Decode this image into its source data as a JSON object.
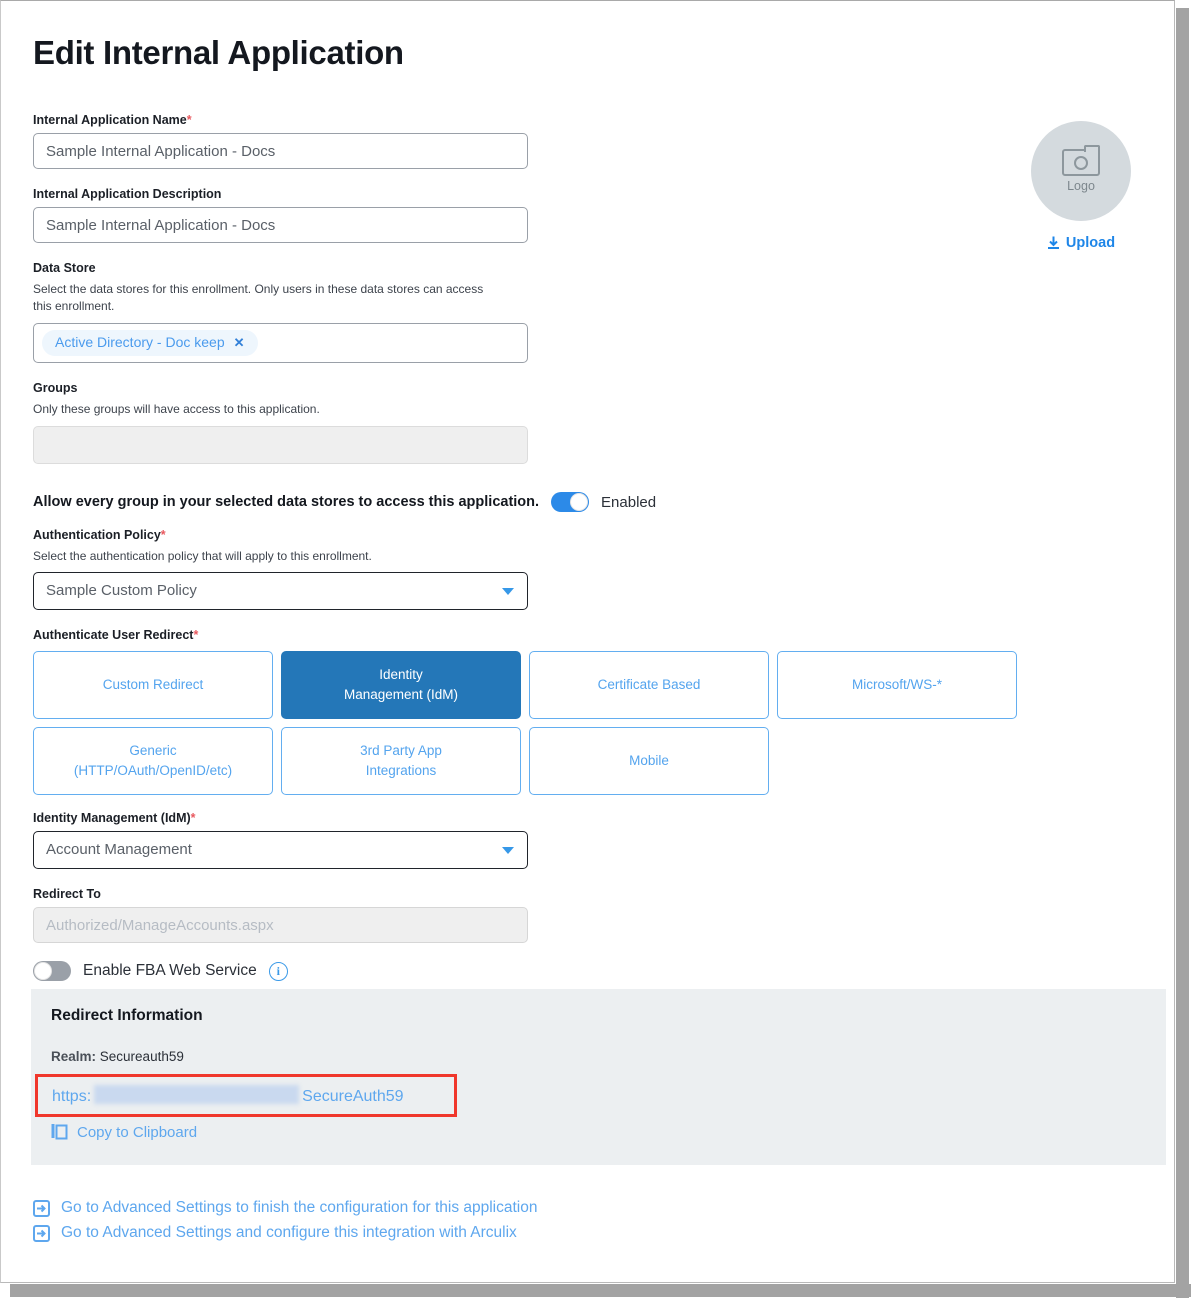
{
  "page": {
    "title": "Edit Internal Application"
  },
  "logo": {
    "placeholder_label": "Logo",
    "upload_label": "Upload",
    "camera_icon": "camera-icon",
    "download_icon": "download-icon"
  },
  "fields": {
    "app_name": {
      "label": "Internal Application Name",
      "required": true,
      "value": "Sample Internal Application - Docs"
    },
    "app_description": {
      "label": "Internal Application Description",
      "required": false,
      "value": "Sample Internal Application - Docs"
    },
    "data_store": {
      "label": "Data Store",
      "help": "Select the data stores for this enrollment. Only users in these data stores can access this enrollment.",
      "chips": [
        {
          "label": "Active Directory - Doc keep",
          "remove_icon": "close-icon"
        }
      ]
    },
    "groups": {
      "label": "Groups",
      "help": "Only these groups will have access to this application.",
      "value": ""
    },
    "allow_every_group": {
      "label": "Allow every group in your selected data stores to access this application.",
      "state": "on",
      "state_label": "Enabled"
    },
    "auth_policy": {
      "label": "Authentication Policy",
      "required": true,
      "help": "Select the authentication policy that will apply to this enrollment.",
      "value": "Sample Custom Policy"
    },
    "authenticate_user_redirect": {
      "label": "Authenticate User Redirect",
      "required": true,
      "options": [
        {
          "label": "Custom Redirect",
          "selected": false
        },
        {
          "label": "Identity\nManagement (IdM)",
          "selected": true
        },
        {
          "label": "Certificate Based",
          "selected": false
        },
        {
          "label": "Microsoft/WS-*",
          "selected": false
        },
        {
          "label": "Generic\n(HTTP/OAuth/OpenID/etc)",
          "selected": false
        },
        {
          "label": "3rd Party App\nIntegrations",
          "selected": false
        },
        {
          "label": "Mobile",
          "selected": false
        }
      ]
    },
    "idm": {
      "label": "Identity Management (IdM)",
      "required": true,
      "value": "Account Management"
    },
    "redirect_to": {
      "label": "Redirect To",
      "value": "Authorized/ManageAccounts.aspx",
      "disabled": true
    },
    "fba_web_service": {
      "label": "Enable FBA Web Service",
      "state": "off",
      "info_icon": "info-icon",
      "info_glyph": "i"
    }
  },
  "redirect_information": {
    "title": "Redirect Information",
    "realm_label": "Realm:",
    "realm_value": "Secureauth59",
    "url_prefix": "https:",
    "url_redacted": true,
    "url_suffix": "SecureAuth59",
    "copy_label": "Copy to Clipboard",
    "copy_icon": "copy-icon",
    "highlight_color": "#f0372c"
  },
  "advanced_links": [
    {
      "icon": "enter-arrow-icon",
      "label": "Go to Advanced Settings to finish the configuration for this application"
    },
    {
      "icon": "enter-arrow-icon",
      "label": "Go to Advanced Settings and configure this integration with Arculix"
    }
  ],
  "colors": {
    "accent_blue": "#2c8ae8",
    "link_blue": "#5ea7ee",
    "selected_btn": "#2477b8",
    "required_red": "#e8585e",
    "panel_gray": "#eceff1"
  }
}
